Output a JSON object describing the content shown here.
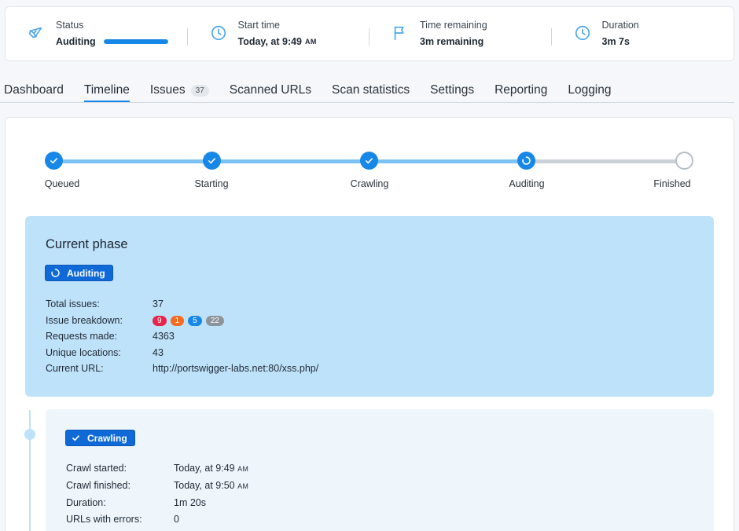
{
  "status_bar": {
    "status": {
      "label": "Status",
      "value": "Auditing",
      "progress": 1.0,
      "icon": "radar-icon"
    },
    "start_time": {
      "label": "Start time",
      "value": "Today, at 9:49",
      "suffix": "AM",
      "icon": "clock-icon"
    },
    "time_remaining": {
      "label": "Time remaining",
      "value": "3m remaining",
      "icon": "flag-icon"
    },
    "duration": {
      "label": "Duration",
      "value": "3m 7s",
      "icon": "clock-icon"
    }
  },
  "tabs": [
    {
      "label": "Dashboard",
      "active": false
    },
    {
      "label": "Timeline",
      "active": true
    },
    {
      "label": "Issues",
      "count": "37",
      "active": false
    },
    {
      "label": "Scanned URLs",
      "active": false
    },
    {
      "label": "Scan statistics",
      "active": false
    },
    {
      "label": "Settings",
      "active": false
    },
    {
      "label": "Reporting",
      "active": false
    },
    {
      "label": "Logging",
      "active": false
    }
  ],
  "stepper": [
    {
      "label": "Queued",
      "state": "done"
    },
    {
      "label": "Starting",
      "state": "done"
    },
    {
      "label": "Crawling",
      "state": "done"
    },
    {
      "label": "Auditing",
      "state": "active"
    },
    {
      "label": "Finished",
      "state": "pending"
    }
  ],
  "current_phase": {
    "title": "Current phase",
    "badge": "Auditing",
    "fields": {
      "total_issues": {
        "label": "Total issues:",
        "value": "37"
      },
      "breakdown": {
        "label": "Issue breakdown:",
        "chips": [
          {
            "value": "9",
            "color": "#e5254a"
          },
          {
            "value": "1",
            "color": "#f26b21"
          },
          {
            "value": "5",
            "color": "#1787e8"
          },
          {
            "value": "22",
            "color": "#8c939b"
          }
        ]
      },
      "requests": {
        "label": "Requests made:",
        "value": "4363"
      },
      "locations": {
        "label": "Unique locations:",
        "value": "43"
      },
      "url": {
        "label": "Current URL:",
        "value": "http://portswigger-labs.net:80/xss.php/"
      }
    }
  },
  "crawling_phase": {
    "badge": "Crawling",
    "fields": {
      "started": {
        "label": "Crawl started:",
        "value": "Today, at 9:49",
        "suffix": "AM"
      },
      "finished": {
        "label": "Crawl finished:",
        "value": "Today, at 9:50",
        "suffix": "AM"
      },
      "duration": {
        "label": "Duration:",
        "value": "1m 20s"
      },
      "errors": {
        "label": "URLs with errors:",
        "value": "0"
      }
    }
  },
  "colors": {
    "accent": "#1787e8",
    "phase_bg": "#bfe2fb",
    "badge_bg": "#0f6ad8"
  }
}
